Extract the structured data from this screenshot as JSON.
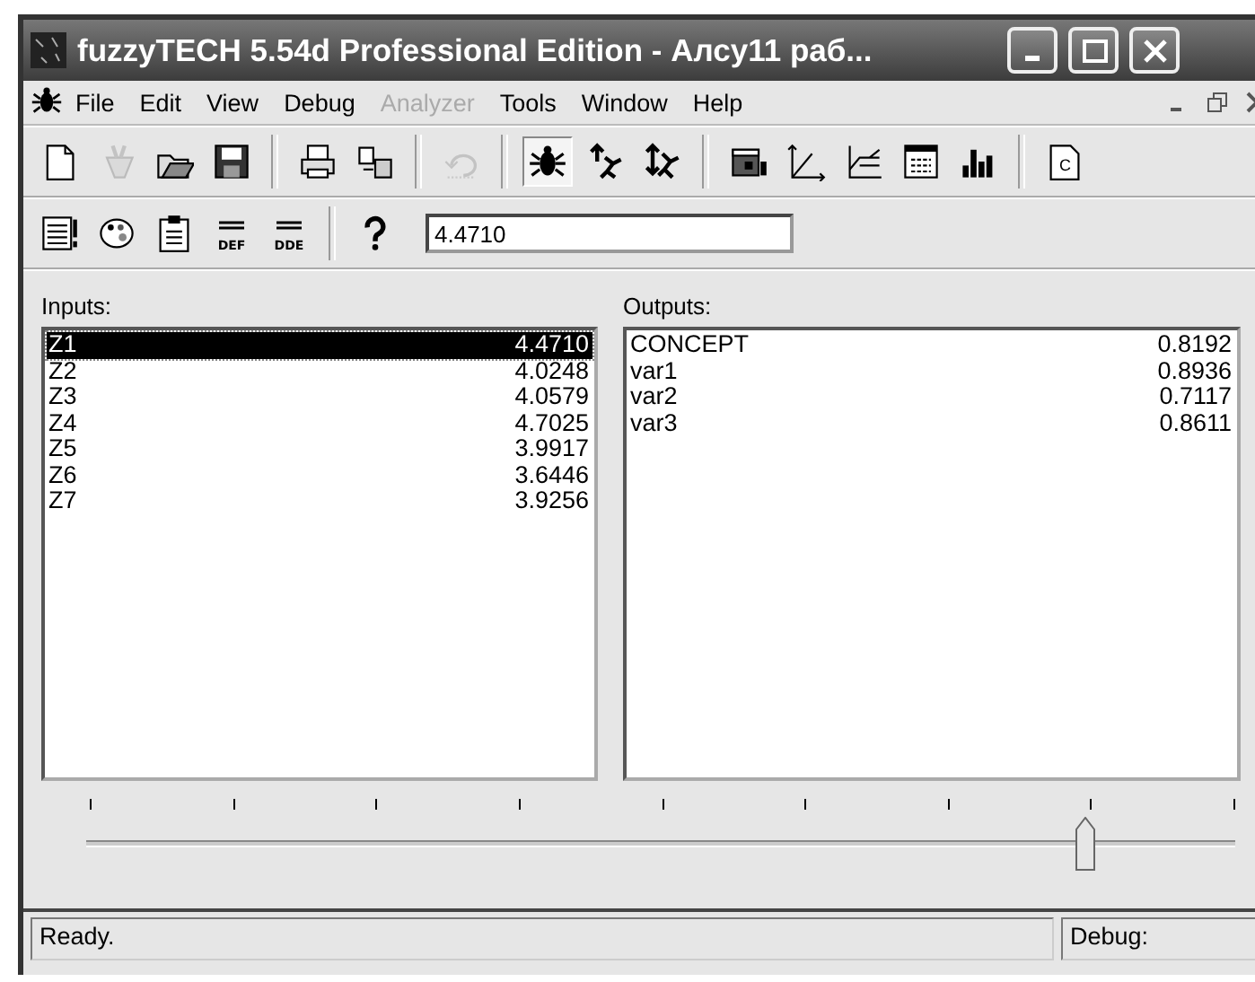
{
  "window": {
    "title": "fuzzyTECH 5.54d Professional Edition - Алсу11 раб..."
  },
  "menu": [
    {
      "label": "File",
      "disabled": false
    },
    {
      "label": "Edit",
      "disabled": false
    },
    {
      "label": "View",
      "disabled": false
    },
    {
      "label": "Debug",
      "disabled": false
    },
    {
      "label": "Analyzer",
      "disabled": true
    },
    {
      "label": "Tools",
      "disabled": false
    },
    {
      "label": "Window",
      "disabled": false
    },
    {
      "label": "Help",
      "disabled": false
    }
  ],
  "toolbar": [
    {
      "kind": "new",
      "disabled": false,
      "pressed": false
    },
    {
      "kind": "wizard",
      "disabled": true,
      "pressed": false
    },
    {
      "kind": "open",
      "disabled": false,
      "pressed": false
    },
    {
      "kind": "save",
      "disabled": false,
      "pressed": false
    },
    {
      "kind": "separator"
    },
    {
      "kind": "print",
      "disabled": false,
      "pressed": false
    },
    {
      "kind": "transfer",
      "disabled": false,
      "pressed": false
    },
    {
      "kind": "separator"
    },
    {
      "kind": "undo",
      "disabled": true,
      "pressed": false
    },
    {
      "kind": "separator"
    },
    {
      "kind": "bug",
      "disabled": false,
      "pressed": true
    },
    {
      "kind": "trace",
      "disabled": false,
      "pressed": false
    },
    {
      "kind": "trace2",
      "disabled": false,
      "pressed": false
    },
    {
      "kind": "separator"
    },
    {
      "kind": "panel",
      "disabled": false,
      "pressed": false
    },
    {
      "kind": "axes",
      "disabled": false,
      "pressed": false
    },
    {
      "kind": "plot",
      "disabled": false,
      "pressed": false
    },
    {
      "kind": "table",
      "disabled": false,
      "pressed": false
    },
    {
      "kind": "bars",
      "disabled": false,
      "pressed": false
    },
    {
      "kind": "separator"
    },
    {
      "kind": "doc",
      "label": "C",
      "disabled": false,
      "pressed": false
    }
  ],
  "toolbar_2": [
    {
      "kind": "sheet",
      "disabled": false
    },
    {
      "kind": "palette",
      "disabled": false
    },
    {
      "kind": "clipboard",
      "disabled": false
    },
    {
      "kind": "text",
      "label": "DEF",
      "disabled": false
    },
    {
      "kind": "text",
      "label": "DDE",
      "disabled": false
    },
    {
      "kind": "separator"
    },
    {
      "kind": "help",
      "disabled": false
    }
  ],
  "value_field": {
    "value": "4.4710"
  },
  "inputs": {
    "label": "Inputs:",
    "items": [
      {
        "name": "Z1",
        "value": "4.4710",
        "selected": true
      },
      {
        "name": "Z2",
        "value": "4.0248",
        "selected": false
      },
      {
        "name": "Z3",
        "value": "4.0579",
        "selected": false
      },
      {
        "name": "Z4",
        "value": "4.7025",
        "selected": false
      },
      {
        "name": "Z5",
        "value": "3.9917",
        "selected": false
      },
      {
        "name": "Z6",
        "value": "3.6446",
        "selected": false
      },
      {
        "name": "Z7",
        "value": "3.9256",
        "selected": false
      }
    ]
  },
  "outputs": {
    "label": "Outputs:",
    "items": [
      {
        "name": "CONCEPT",
        "value": "0.8192",
        "selected": false
      },
      {
        "name": "var1",
        "value": "0.8936",
        "selected": false
      },
      {
        "name": "var2",
        "value": "0.7117",
        "selected": false
      },
      {
        "name": "var3",
        "value": "0.8611",
        "selected": false
      }
    ]
  },
  "slider": {
    "level": 0.87
  },
  "status_bar": {
    "message": "Ready.",
    "mode": "Debug:"
  }
}
